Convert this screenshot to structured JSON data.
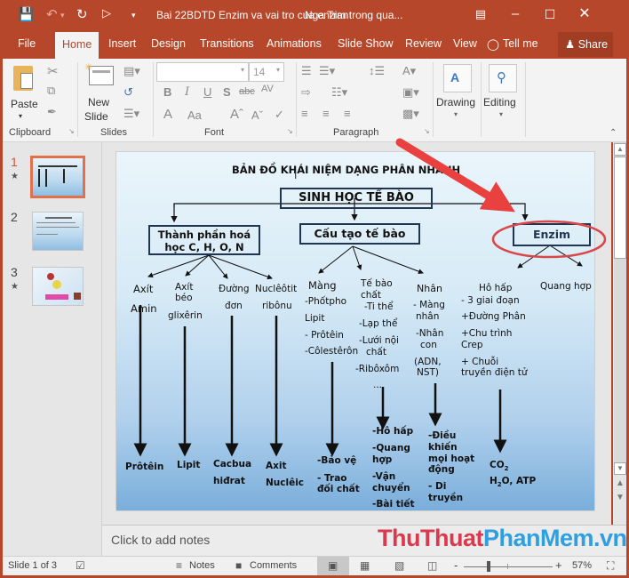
{
  "titlebar": {
    "document_title": "Bai 22BDTD Enzim va vai tro cua enzim trong qua...",
    "user_name": "Nga Tran",
    "icons": {
      "save": "save-icon",
      "undo": "undo-icon",
      "redo": "redo-icon",
      "present": "start-from-beginning-icon",
      "customize": "customize-quick-access-icon"
    }
  },
  "tabs": [
    {
      "label": "File"
    },
    {
      "label": "Home",
      "active": true
    },
    {
      "label": "Insert"
    },
    {
      "label": "Design"
    },
    {
      "label": "Transitions"
    },
    {
      "label": "Animations"
    },
    {
      "label": "Slide Show"
    },
    {
      "label": "Review"
    },
    {
      "label": "View"
    },
    {
      "label": "Tell me"
    }
  ],
  "share_label": "Share",
  "ribbon": {
    "clipboard": {
      "label": "Clipboard",
      "paste_label": "Paste"
    },
    "slides": {
      "label": "Slides",
      "new_slide_line1": "New",
      "new_slide_line2": "Slide"
    },
    "font": {
      "label": "Font",
      "font_name": "",
      "font_size": "14",
      "bold": "B",
      "italic": "I",
      "underline": "U",
      "shadow": "S",
      "strike": "abc",
      "spacing": "AV",
      "color": "A",
      "case": "Aa"
    },
    "paragraph": {
      "label": "Paragraph"
    },
    "drawing": {
      "label": "Drawing"
    },
    "editing": {
      "label": "Editing"
    }
  },
  "thumbnails": [
    {
      "number": "1",
      "starred": true,
      "active": true
    },
    {
      "number": "2",
      "starred": false,
      "active": false
    },
    {
      "number": "3",
      "starred": true,
      "active": false
    }
  ],
  "slide": {
    "title": "BẢN ĐỒ KHÁI NIỆM DẠNG PHÂN NHÁNH",
    "root": "SINH HỌC TẾ BÀO",
    "branches": {
      "chemical": {
        "line1": "Thành phần hoá",
        "line2": "học C, H, O, N",
        "children": [
          {
            "name_lines": [
              "Axít",
              "Amin"
            ],
            "result_lines": [
              "Prôtêin"
            ]
          },
          {
            "name_lines": [
              "Axít",
              "béo",
              "glixêrin"
            ],
            "result_lines": [
              "Lipit"
            ]
          },
          {
            "name_lines": [
              "Đường",
              "đơn"
            ],
            "result_lines": [
              "Cacbua",
              "hiđrat"
            ]
          },
          {
            "name_lines": [
              "Nuclêôtit",
              "ribônu"
            ],
            "result_lines": [
              "Axit",
              "Nuclêic"
            ]
          }
        ]
      },
      "structure": {
        "label": "Cấu tạo tế bào",
        "membrane": {
          "lines": [
            "Màng",
            "-Phốtpho",
            "Lipit",
            "- Prôtêin",
            "-Côlestêrôn"
          ],
          "result_lines": [
            "-Bảo vệ",
            "- Trao",
            "đối chất"
          ]
        },
        "cytoplasm": {
          "lines": [
            "Tế bào",
            "chất",
            "-Ti thể",
            "-Lạp thể",
            "-Lưới nội",
            "chất",
            "-Ribôxôm",
            "..."
          ],
          "result_lines": [
            "-Hô hấp",
            "-Quang",
            "hợp",
            "-Vận",
            "chuyển",
            "-Bài tiết"
          ]
        },
        "nucleus": {
          "lines": [
            "Nhân",
            "- Màng",
            "nhân",
            "-Nhân",
            "con",
            "(ADN,",
            "NST)"
          ],
          "result_lines": [
            "-Điều",
            "khiến",
            "mọi hoạt",
            "động",
            "- Di",
            "truyền"
          ]
        }
      },
      "enzyme": {
        "label": "Enzim",
        "respiration": {
          "lines": [
            "Hô hấp",
            "- 3 giai đoạn",
            "+Đường Phân",
            "+Chu trình",
            "Crep",
            "+ Chuỗi",
            "truyền điện tử"
          ],
          "result_co2": "CO",
          "result_co2_sub": "2",
          "result_h": "H",
          "result_h_sub": "2",
          "result_rest": "O, ATP"
        },
        "photosynthesis": "Quang hợp"
      }
    },
    "annotation": {
      "arrow_color": "#e8413f",
      "circle_color": "#d9474a",
      "highlighted": "Enzim"
    }
  },
  "notes": {
    "placeholder": "Click to add notes"
  },
  "statusbar": {
    "slide_info": "Slide 1 of 3",
    "notes_label": "Notes",
    "comments_label": "Comments",
    "zoom_minus": "-",
    "zoom_plus": "+",
    "zoom_level": "57%",
    "zoom_fraction": 0.57
  },
  "watermark": {
    "part1": "ThuThuat",
    "part2": "PhanMem",
    "part3": ".vn"
  },
  "colors": {
    "accent": "#b7472a",
    "tab_active_text": "#b7472a",
    "thumbnail_active_border": "#e1704d",
    "slide_box_border": "#1f3552"
  }
}
